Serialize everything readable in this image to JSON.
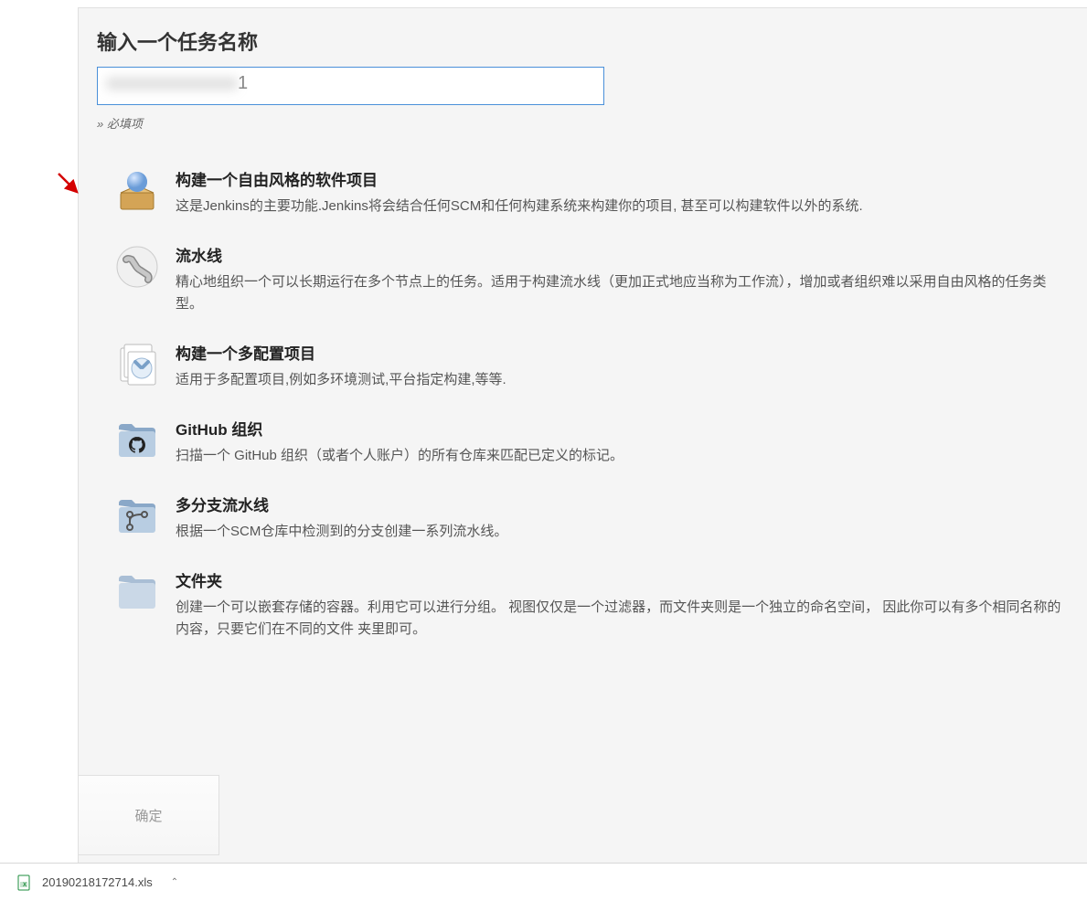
{
  "header": {
    "title": "输入一个任务名称",
    "input_value_visible_suffix": "1",
    "input_blurred_prefix": "xxxxxxxxxxxxx",
    "required_prefix": "» ",
    "required_text": "必填项"
  },
  "options": [
    {
      "icon": "freestyle",
      "title": "构建一个自由风格的软件项目",
      "desc": "这是Jenkins的主要功能.Jenkins将会结合任何SCM和任何构建系统来构建你的项目, 甚至可以构建软件以外的系统."
    },
    {
      "icon": "pipeline",
      "title": "流水线",
      "desc": "精心地组织一个可以长期运行在多个节点上的任务。适用于构建流水线（更加正式地应当称为工作流），增加或者组织难以采用自由风格的任务类型。"
    },
    {
      "icon": "multiconfig",
      "title": "构建一个多配置项目",
      "desc": "适用于多配置项目,例如多环境测试,平台指定构建,等等."
    },
    {
      "icon": "github-org",
      "title": "GitHub 组织",
      "desc": "扫描一个 GitHub 组织（或者个人账户）的所有仓库来匹配已定义的标记。"
    },
    {
      "icon": "multibranch",
      "title": "多分支流水线",
      "desc": "根据一个SCM仓库中检测到的分支创建一系列流水线。"
    },
    {
      "icon": "folder",
      "title": "文件夹",
      "desc": "创建一个可以嵌套存储的容器。利用它可以进行分组。 视图仅仅是一个过滤器，而文件夹则是一个独立的命名空间， 因此你可以有多个相同名称的内容，只要它们在不同的文件 夹里即可。"
    }
  ],
  "footer": {
    "ok_label": "确定"
  },
  "downloads": {
    "filename": "20190218172714.xls"
  }
}
